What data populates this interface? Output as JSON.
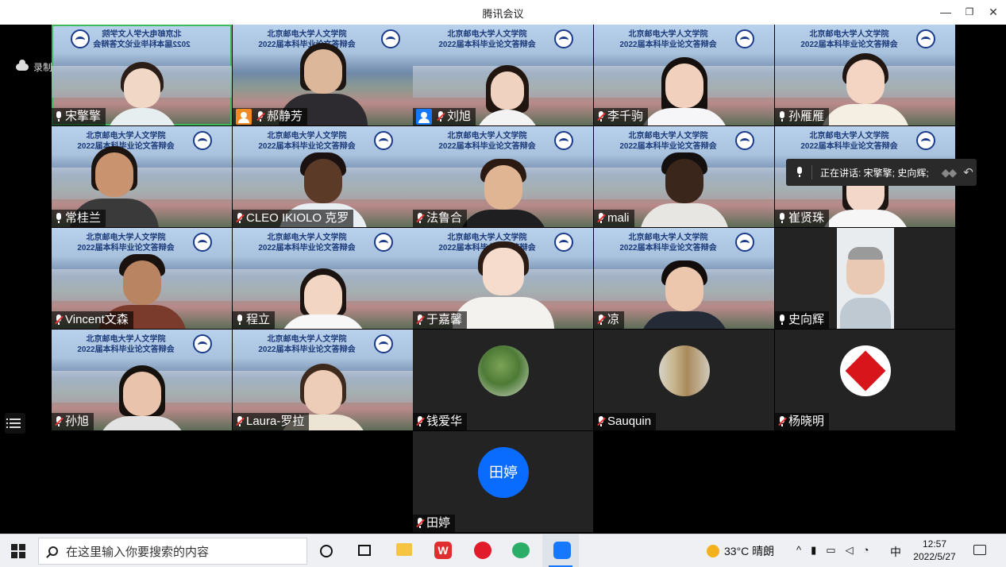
{
  "window": {
    "title": "腾讯会议",
    "minimize": "—",
    "maximize": "❐",
    "close": "✕"
  },
  "recording": {
    "label": "录制中"
  },
  "speaking": {
    "label": "正在讲话: 宋擎擎; 史向辉;"
  },
  "banner": {
    "line1": "北京邮电大学人文学院",
    "line2": "2022届本科毕业论文答辩会"
  },
  "participants": [
    {
      "name": "宋擎擎",
      "mic": "on"
    },
    {
      "name": "郝静芳",
      "mic": "muted",
      "badge": "host"
    },
    {
      "name": "刘旭",
      "mic": "muted",
      "badge": "cohost"
    },
    {
      "name": "李千驹",
      "mic": "muted"
    },
    {
      "name": "孙雁雁",
      "mic": "on"
    },
    {
      "name": "常桂兰",
      "mic": "on"
    },
    {
      "name": "CLEO IKIOLO 克罗",
      "mic": "muted"
    },
    {
      "name": "法鲁合",
      "mic": "muted"
    },
    {
      "name": "mali",
      "mic": "muted"
    },
    {
      "name": "崔贤珠",
      "mic": "on"
    },
    {
      "name": "Vincent文森",
      "mic": "muted"
    },
    {
      "name": "程立",
      "mic": "on"
    },
    {
      "name": "于嘉馨",
      "mic": "muted"
    },
    {
      "name": "凉",
      "mic": "muted"
    },
    {
      "name": "史向辉",
      "mic": "on"
    },
    {
      "name": "孙旭",
      "mic": "muted"
    },
    {
      "name": "Laura-罗拉",
      "mic": "muted"
    },
    {
      "name": "钱爱华",
      "mic": "muted"
    },
    {
      "name": "Sauquin",
      "mic": "muted"
    },
    {
      "name": "杨晓明",
      "mic": "muted"
    },
    {
      "name": "田婷",
      "mic": "muted",
      "avatar_text": "田婷"
    }
  ],
  "taskbar": {
    "search_placeholder": "在这里输入你要搜索的内容",
    "wps_label": "W",
    "weather": "33°C 晴朗",
    "ime": "中",
    "time": "12:57",
    "date": "2022/5/27"
  }
}
